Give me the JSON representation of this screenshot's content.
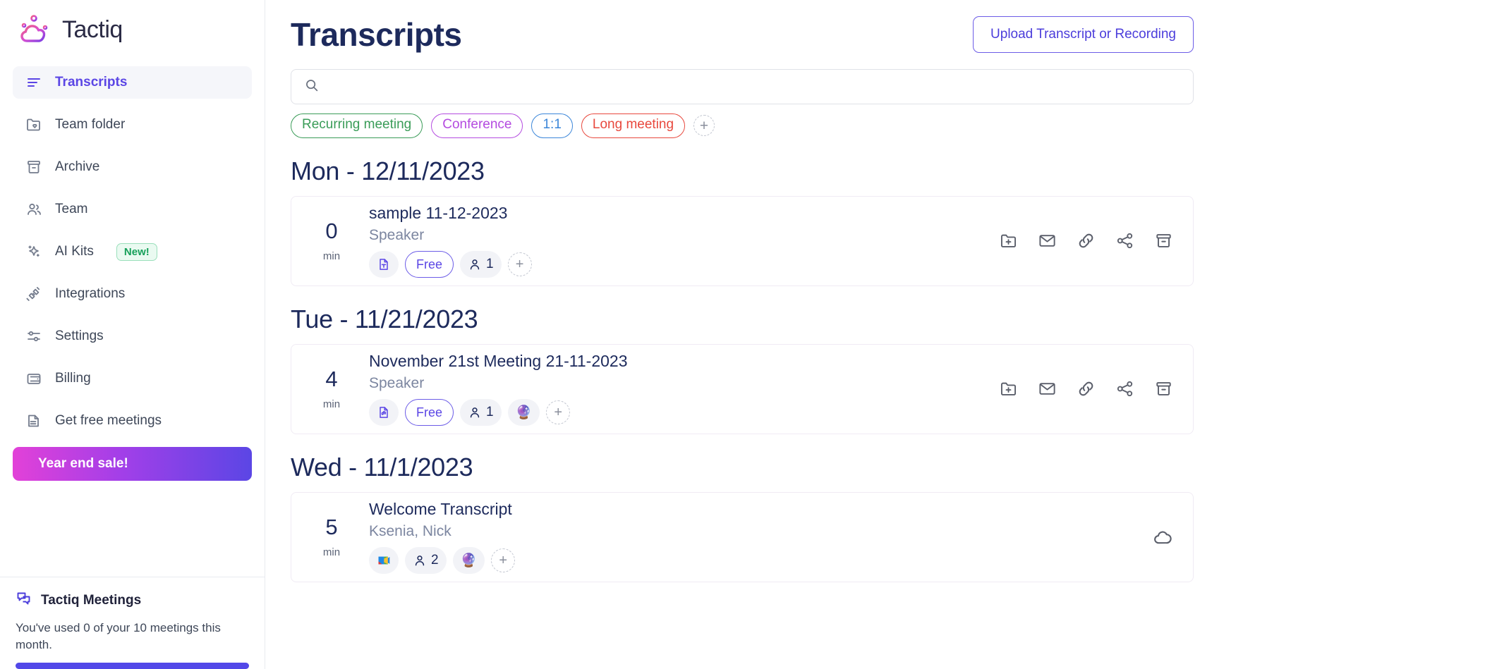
{
  "brand": {
    "name": "Tactiq",
    "logo_icon": "tactiq-cloud-logo"
  },
  "sidebar": {
    "items": [
      {
        "label": "Transcripts",
        "icon": "list-lines-icon",
        "active": true
      },
      {
        "label": "Team folder",
        "icon": "folder-heart-icon",
        "active": false
      },
      {
        "label": "Archive",
        "icon": "archive-box-icon",
        "active": false
      },
      {
        "label": "Team",
        "icon": "users-icon",
        "active": false
      },
      {
        "label": "AI Kits",
        "icon": "sparkles-icon",
        "active": false,
        "badge": "New!"
      },
      {
        "label": "Integrations",
        "icon": "plug-icon",
        "active": false
      },
      {
        "label": "Settings",
        "icon": "sliders-icon",
        "active": false
      },
      {
        "label": "Billing",
        "icon": "wallet-icon",
        "active": false
      },
      {
        "label": "Get free meetings",
        "icon": "tag-icon",
        "active": false
      }
    ],
    "promo": {
      "label": "Year end sale!",
      "icon": "gift-icon"
    },
    "meetings_panel": {
      "title": "Tactiq Meetings",
      "icon": "chat-bubbles-icon",
      "usage_text": "You've used 0 of your 10 meetings this month.",
      "progress_percent": 100
    }
  },
  "header": {
    "title": "Transcripts",
    "upload_button": "Upload Transcript or Recording"
  },
  "search": {
    "value": "",
    "placeholder": "",
    "icon": "search-icon"
  },
  "filters": {
    "tags": [
      {
        "label": "Recurring meeting",
        "color": "#3a9c58"
      },
      {
        "label": "Conference",
        "color": "#b44be0"
      },
      {
        "label": "1:1",
        "color": "#3b86d9"
      },
      {
        "label": "Long meeting",
        "color": "#e8483d"
      }
    ],
    "add_label": "+"
  },
  "groups": [
    {
      "day_label": "Mon - 12/11/2023",
      "items": [
        {
          "duration": "0",
          "duration_unit": "min",
          "title": "sample 11-12-2023",
          "speakers": "Speaker",
          "chips": [
            {
              "type": "icon",
              "icon": "text-file-icon"
            },
            {
              "type": "badge",
              "label": "Free"
            },
            {
              "type": "people",
              "icon": "person-icon",
              "count": "1"
            },
            {
              "type": "add",
              "label": "+"
            }
          ],
          "actions": [
            "folder-plus-icon",
            "envelope-icon",
            "link-icon",
            "share-icon",
            "archive-icon"
          ]
        }
      ]
    },
    {
      "day_label": "Tue - 11/21/2023",
      "items": [
        {
          "duration": "4",
          "duration_unit": "min",
          "title": "November 21st Meeting 21-11-2023",
          "speakers": "Speaker",
          "chips": [
            {
              "type": "icon",
              "icon": "audio-file-icon"
            },
            {
              "type": "badge",
              "label": "Free"
            },
            {
              "type": "people",
              "icon": "person-icon",
              "count": "1"
            },
            {
              "type": "emoji",
              "label": "🔮",
              "icon": "crystal-ball-icon"
            },
            {
              "type": "add",
              "label": "+"
            }
          ],
          "actions": [
            "folder-plus-icon",
            "envelope-icon",
            "link-icon",
            "share-icon",
            "archive-icon"
          ]
        }
      ]
    },
    {
      "day_label": "Wed - 11/1/2023",
      "items": [
        {
          "duration": "5",
          "duration_unit": "min",
          "title": "Welcome Transcript",
          "speakers": "Ksenia, Nick",
          "chips": [
            {
              "type": "gmeet",
              "icon": "google-meet-icon"
            },
            {
              "type": "people",
              "icon": "person-icon",
              "count": "2"
            },
            {
              "type": "emoji",
              "label": "🔮",
              "icon": "crystal-ball-icon"
            },
            {
              "type": "add",
              "label": "+"
            }
          ],
          "actions": [
            "cloud-icon"
          ]
        }
      ]
    }
  ],
  "colors": {
    "accent": "#5b46e5",
    "title": "#1d2a5c",
    "muted": "#7c86a0",
    "promo_from": "#e241d8",
    "promo_to": "#5b46e5",
    "new_badge_text": "#17a05a"
  }
}
